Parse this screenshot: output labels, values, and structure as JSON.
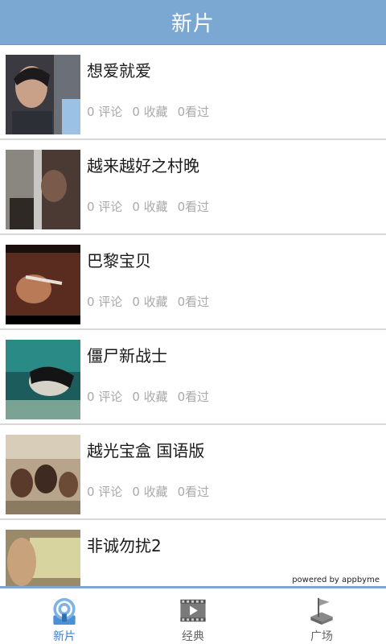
{
  "header": {
    "title": "新片"
  },
  "movies": [
    {
      "title": "想爱就爱",
      "comments": "0 评论",
      "favorites": "0 收藏",
      "watched": "0看过"
    },
    {
      "title": "越来越好之村晚",
      "comments": "0 评论",
      "favorites": "0 收藏",
      "watched": "0看过"
    },
    {
      "title": "巴黎宝贝",
      "comments": "0 评论",
      "favorites": "0 收藏",
      "watched": "0看过"
    },
    {
      "title": "僵尸新战士",
      "comments": "0 评论",
      "favorites": "0 收藏",
      "watched": "0看过"
    },
    {
      "title": "越光宝盒 国语版",
      "comments": "0 评论",
      "favorites": "0 收藏",
      "watched": "0看过"
    },
    {
      "title": "非诚勿扰2",
      "comments": "",
      "favorites": "",
      "watched": ""
    }
  ],
  "footer": {
    "powered_by": "powered by appbyme"
  },
  "tabs": [
    {
      "label": "新片",
      "icon": "radar-icon",
      "active": true
    },
    {
      "label": "经典",
      "icon": "film-play-icon",
      "active": false
    },
    {
      "label": "广场",
      "icon": "flag-map-icon",
      "active": false
    }
  ],
  "colors": {
    "header_bg": "#7ba7d3",
    "active_tab": "#3a82c6",
    "stat_text": "#a9a9a9"
  }
}
